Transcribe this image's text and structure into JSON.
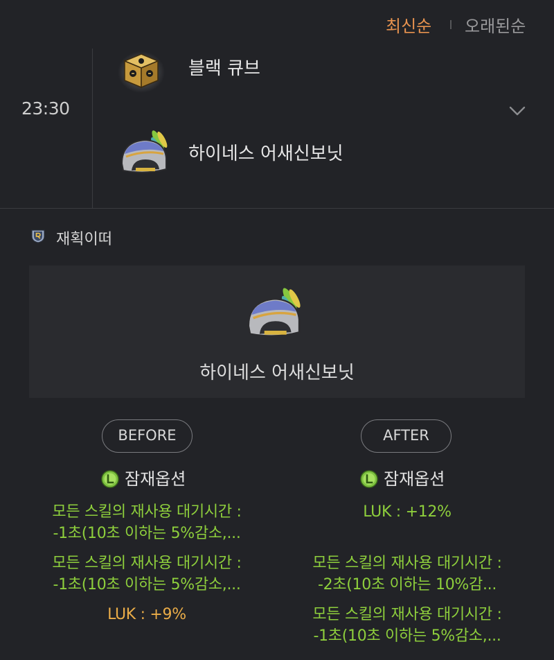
{
  "sort": {
    "newest_label": "최신순",
    "oldest_label": "오래된순"
  },
  "history": {
    "time": "23:30",
    "cube_name": "블랙 큐브",
    "item_name": "하이네스 어새신보닛"
  },
  "server": {
    "name": "재획이떠"
  },
  "card": {
    "item_name": "하이네스 어새신보닛"
  },
  "before": {
    "pill_label": "BEFORE",
    "option_title": "잠재옵션",
    "lines": [
      {
        "text": "모든 스킬의 재사용 대기시간 :",
        "color": "green"
      },
      {
        "text": "-1초(10초 이하는 5%감소,...",
        "color": "green"
      },
      {
        "text": "모든 스킬의 재사용 대기시간 :",
        "color": "green"
      },
      {
        "text": "-1초(10초 이하는 5%감소,...",
        "color": "green"
      },
      {
        "text": "LUK : +9%",
        "color": "gold"
      }
    ]
  },
  "after": {
    "pill_label": "AFTER",
    "option_title": "잠재옵션",
    "lines": [
      {
        "text": "LUK : +12%",
        "color": "green"
      },
      {
        "text": "모든 스킬의 재사용 대기시간 :",
        "color": "green"
      },
      {
        "text": "-2초(10초 이하는 10%감...",
        "color": "green"
      },
      {
        "text": "모든 스킬의 재사용 대기시간 :",
        "color": "green"
      },
      {
        "text": "-1초(10초 이하는 5%감소,...",
        "color": "green"
      }
    ]
  },
  "colors": {
    "background": "#222327",
    "card_background": "#2a2b2f",
    "accent_orange": "#e8934f",
    "option_green": "#8ecf3c",
    "option_gold": "#ebad48",
    "legendary_badge": "#7fc241"
  },
  "icons": {
    "cube": "black-cube-icon",
    "item": "assassin-bonnet-icon",
    "server": "reboot-server-icon",
    "badge": "legendary-grade-icon",
    "expand": "chevron-down-icon"
  }
}
